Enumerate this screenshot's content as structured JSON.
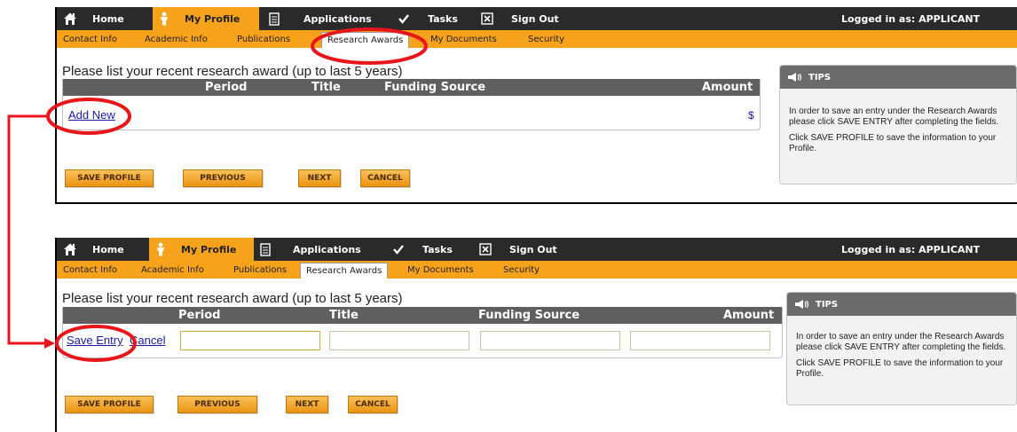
{
  "nav": {
    "home": "Home",
    "my_profile": "My Profile",
    "applications": "Applications",
    "tasks": "Tasks",
    "sign_out": "Sign Out",
    "logged_in": "Logged in as: APPLICANT"
  },
  "subnav": {
    "contact_info": "Contact Info",
    "academic_info": "Academic Info",
    "publications": "Publications",
    "research_awards": "Research Awards",
    "my_documents": "My Documents",
    "security": "Security"
  },
  "instruction": "Please list your recent research award (up to last 5 years)",
  "table": {
    "period": "Period",
    "title": "Title",
    "funding_source": "Funding Source",
    "amount": "Amount",
    "add_new": "Add New",
    "currency": "$",
    "save_entry": "Save Entry",
    "cancel": "Cancel",
    "inputs": {
      "period": "",
      "title": "",
      "funding_source": "",
      "amount": ""
    }
  },
  "buttons": {
    "save_profile": "SAVE PROFILE",
    "previous": "PREVIOUS",
    "next": "NEXT",
    "cancel": "CANCEL"
  },
  "tips": {
    "heading": "TIPS",
    "tip1": "In order to save an entry under the Research Awards please click SAVE ENTRY after completing the fields.",
    "tip2": "Click SAVE PROFILE to save the information to your Profile."
  },
  "colors": {
    "nav_bg": "#2a2a2a",
    "accent_orange": "#f7a21b",
    "table_header": "#5f5f5f",
    "highlight_red": "#e8161b",
    "link_blue": "#1a1aa6"
  },
  "icons": {
    "home": "house-icon",
    "my_profile": "person-icon",
    "applications": "document-icon",
    "tasks": "checkmark-icon",
    "sign_out": "x-box-icon",
    "tips": "megaphone-icon"
  }
}
